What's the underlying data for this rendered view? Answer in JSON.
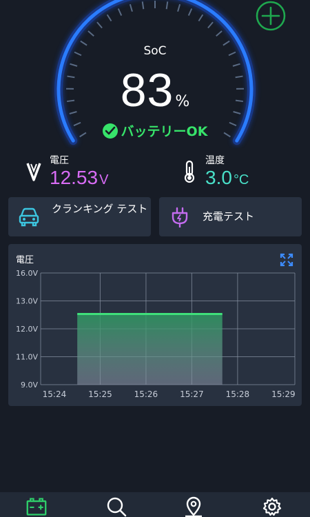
{
  "gauge": {
    "label": "SoC",
    "value": "83",
    "unit": "%",
    "fraction": 0.83,
    "status": "バッテリーOK",
    "colors": {
      "arc": "#2a7cff",
      "arc_glow": "#1a4fd6",
      "ticks": "#5a6b84",
      "status": "#37e36a"
    }
  },
  "actions": {
    "add_icon": "plus-circle-icon",
    "add_color": "#1fa84f"
  },
  "metrics": {
    "voltage": {
      "label": "電圧",
      "value": "12.53",
      "unit": "V",
      "color": "#d86cf5",
      "icon": "voltage-icon"
    },
    "temperature": {
      "label": "温度",
      "value": "3.0",
      "unit": "°C",
      "color": "#49e0c8",
      "icon": "thermometer-icon"
    }
  },
  "buttons": {
    "cranking_test": {
      "label": "クランキング テスト",
      "icon": "car-icon",
      "icon_color": "#3cc6e0"
    },
    "charge_test": {
      "label": "充電テスト",
      "icon": "plug-icon",
      "icon_color": "#c46cf0"
    }
  },
  "chart_card": {
    "title": "電圧",
    "expand_icon": "expand-icon"
  },
  "chart_data": {
    "type": "area",
    "title": "",
    "xlabel": "",
    "ylabel": "",
    "y_tick_labels": [
      "16.0V",
      "13.0V",
      "12.0V",
      "11.0V",
      "9.0V"
    ],
    "x_tick_labels": [
      "15:24",
      "15:25",
      "15:26",
      "15:27",
      "15:28",
      "15:29"
    ],
    "series": [
      {
        "x": [
          "15:24:30",
          "15:27:40"
        ],
        "values": [
          12.53,
          12.53
        ],
        "color": "#3fe07a"
      }
    ],
    "grid": true
  },
  "nav": [
    {
      "name": "battery",
      "icon": "battery-icon",
      "active": true
    },
    {
      "name": "search",
      "icon": "search-icon",
      "active": false
    },
    {
      "name": "location",
      "icon": "location-pin-icon",
      "active": false
    },
    {
      "name": "settings",
      "icon": "gear-icon",
      "active": false
    }
  ],
  "colors": {
    "background": "#171c26",
    "card": "#283140",
    "nav": "#222a37",
    "active_nav": "#2fd06b"
  }
}
